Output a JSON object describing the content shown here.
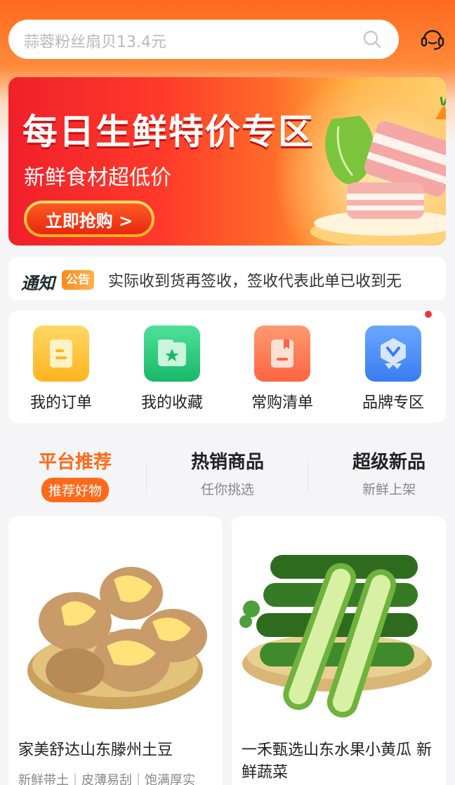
{
  "search": {
    "placeholder": "蒜蓉粉丝扇贝13.4元"
  },
  "banner": {
    "title": "每日生鲜特价专区",
    "subtitle": "新鲜食材超低价",
    "button_label": "立即抢购 >"
  },
  "notice": {
    "logo": "通知",
    "tag": "公告",
    "text": "实际收到货再签收，签收代表此单已收到无"
  },
  "quick_entries": [
    {
      "label": "我的订单",
      "icon": "order-icon",
      "color": "#ffc333"
    },
    {
      "label": "我的收藏",
      "icon": "favorite-icon",
      "color": "#2ecf7e"
    },
    {
      "label": "常购清单",
      "icon": "shopping-list-icon",
      "color": "#ff7a55"
    },
    {
      "label": "品牌专区",
      "icon": "brand-icon",
      "color": "#4a8cff"
    }
  ],
  "tabs": [
    {
      "title": "平台推荐",
      "subtitle": "推荐好物",
      "active": true
    },
    {
      "title": "热销商品",
      "subtitle": "任你挑选",
      "active": false
    },
    {
      "title": "超级新品",
      "subtitle": "新鲜上架",
      "active": false
    }
  ],
  "products": [
    {
      "title": "家美舒达山东滕州土豆",
      "tags": "新鲜带土｜皮薄易刮｜饱满厚实"
    },
    {
      "title": "一禾甄选山东水果小黄瓜 新鲜蔬菜",
      "tags": ""
    }
  ],
  "colors": {
    "accent": "#ff6a1a",
    "header_gradient_start": "#ff6a1f",
    "banner_red": "#f0202a"
  }
}
